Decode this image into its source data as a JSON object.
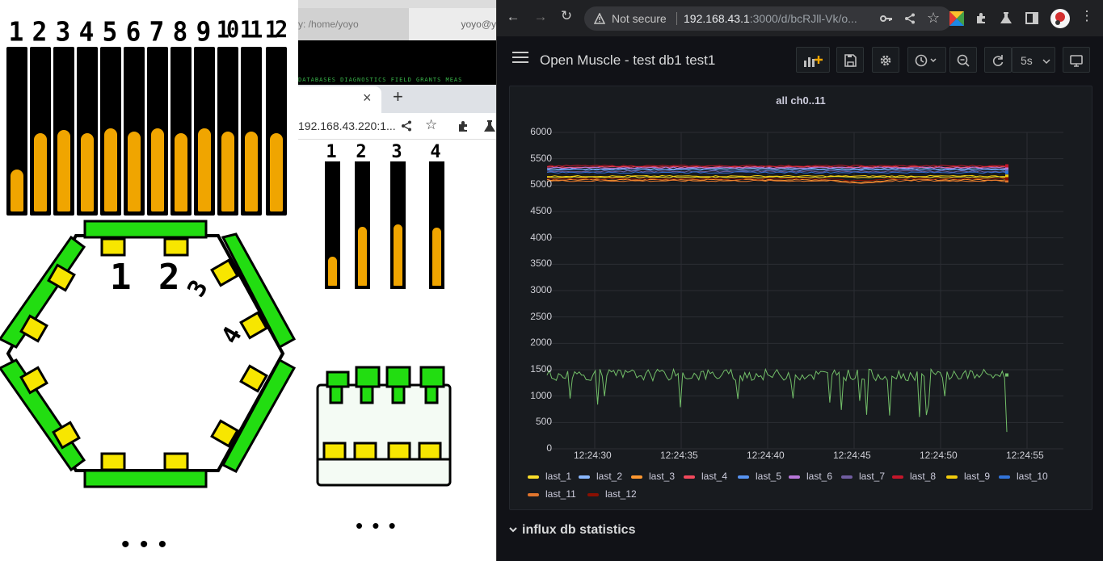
{
  "left_window": {
    "numbers": [
      "1",
      "2",
      "3",
      "4",
      "5",
      "6",
      "7",
      "8",
      "9",
      "10",
      "11",
      "12"
    ],
    "levels": [
      0.26,
      0.49,
      0.51,
      0.49,
      0.52,
      0.5,
      0.52,
      0.49,
      0.52,
      0.5,
      0.5,
      0.49
    ],
    "hex_labels": [
      "1",
      "2",
      "3",
      "4"
    ],
    "more_dots": "• • •"
  },
  "middle_window": {
    "terminal_tab_left": "y: /home/yoyo",
    "terminal_tab_right": "yoyo@y",
    "terminal_menu": "DATABASES  DIAGNOSTICS  FIELD  GRANTS  MEAS",
    "browser_tab_close": "×",
    "browser_new_tab": "+",
    "browser_url": "192.168.43.220:1...",
    "numbers": [
      "1",
      "2",
      "3",
      "4"
    ],
    "levels": [
      0.24,
      0.49,
      0.51,
      0.48
    ],
    "more_dots": "• • •"
  },
  "grafana_window": {
    "browser": {
      "not_secure": "Not secure",
      "url_host": "192.168.43.1",
      "url_rest": ":3000/d/bcRJll-Vk/o..."
    },
    "dashboard_title": "Open Muscle - test db1 test1",
    "refresh_interval": "5s",
    "panel_title": "all ch0..11",
    "collapsed_row": "influx db statistics",
    "colors": {
      "background": "#111217",
      "panel": "#181b1f",
      "grid": "#2b2e33"
    }
  },
  "chart_data": {
    "type": "line",
    "title": "all ch0..11",
    "x": [
      "12:24:30",
      "12:24:35",
      "12:24:40",
      "12:24:45",
      "12:24:50",
      "12:24:55"
    ],
    "ylim": [
      0,
      6000
    ],
    "yticks": [
      "6000",
      "5500",
      "5000",
      "4500",
      "4000",
      "3500",
      "3000",
      "2500",
      "2000",
      "1500",
      "1000",
      "500",
      "0"
    ],
    "grid": true,
    "legend_position": "bottom",
    "series": [
      {
        "name": "last_1",
        "color": "#fade2a",
        "approx_value": 5150
      },
      {
        "name": "last_2",
        "color": "#8ab8ff",
        "approx_value": 5310
      },
      {
        "name": "last_3",
        "color": "#ff9830",
        "approx_value": 5100
      },
      {
        "name": "last_4",
        "color": "#f2495c",
        "approx_value": 5345
      },
      {
        "name": "last_5",
        "color": "#5794f2",
        "approx_value": 5290
      },
      {
        "name": "last_6",
        "color": "#b877d9",
        "approx_value": 5330
      },
      {
        "name": "last_7",
        "color": "#705da0",
        "approx_value": 5260
      },
      {
        "name": "last_8",
        "color": "#c4162a",
        "approx_value": 5365
      },
      {
        "name": "last_9",
        "color": "#f2cc0c",
        "approx_value": 5170
      },
      {
        "name": "last_10",
        "color": "#3274d9",
        "approx_value": 5240
      },
      {
        "name": "last_11",
        "color": "#e0752d",
        "approx_value": 5080
      },
      {
        "name": "last_12",
        "color": "#890f02",
        "approx_value": 5120
      },
      {
        "name": "(unlabeled)",
        "color": "#73bf69",
        "approx_value": 1400
      }
    ]
  }
}
